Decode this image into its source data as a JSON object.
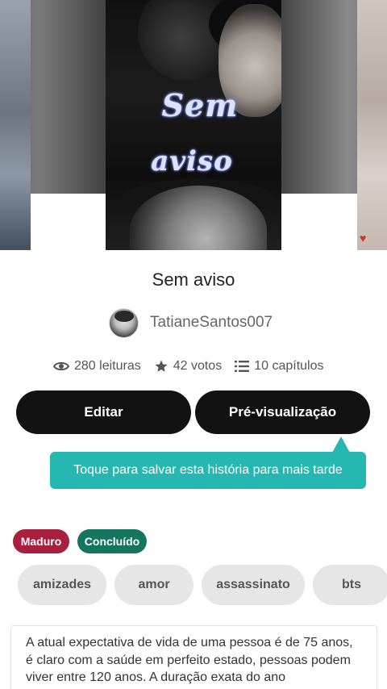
{
  "cover": {
    "title_line1": "Sem",
    "title_line2": "aviso"
  },
  "story": {
    "title": "Sem aviso",
    "author": "TatianeSantos007"
  },
  "stats": {
    "reads": "280 leituras",
    "votes": "42 votos",
    "chapters": "10 capítulos"
  },
  "actions": {
    "edit_label": "Editar",
    "preview_label": "Pré-visualização"
  },
  "tooltip": {
    "text": "Toque para salvar esta história para mais tarde",
    "color": "#24b8b0"
  },
  "badges": [
    {
      "label": "Maduro",
      "color": "#a8203e"
    },
    {
      "label": "Concluído",
      "color": "#14765f"
    }
  ],
  "tags": [
    "amizades",
    "amor",
    "assassinato",
    "bts"
  ],
  "description": "A atual expectativa de vida de uma pessoa é de 75 anos, é claro com a saúde em perfeito estado, pessoas podem viver entre 120 anos. A duração exata do ano"
}
